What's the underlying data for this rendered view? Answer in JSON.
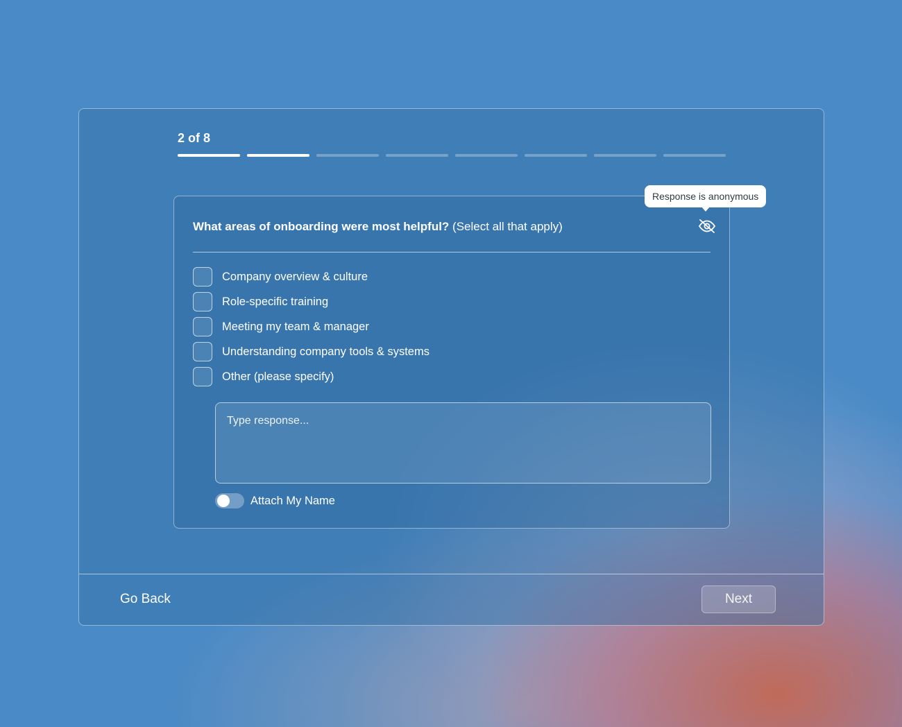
{
  "progress": {
    "label": "2 of 8",
    "current": 2,
    "total": 8
  },
  "question": {
    "text": "What areas of onboarding were most helpful?",
    "hint": "(Select all that apply)",
    "anonymous_tooltip": "Response is anonymous",
    "icon": "eye-off-icon"
  },
  "options": [
    {
      "label": "Company overview & culture",
      "checked": false
    },
    {
      "label": "Role-specific training",
      "checked": false
    },
    {
      "label": "Meeting my team & manager",
      "checked": false
    },
    {
      "label": "Understanding company tools & systems",
      "checked": false
    },
    {
      "label": "Other (please specify)",
      "checked": false
    }
  ],
  "response": {
    "placeholder": "Type response...",
    "value": ""
  },
  "attach_name": {
    "label": "Attach My Name",
    "enabled": false
  },
  "footer": {
    "back_label": "Go Back",
    "next_label": "Next"
  },
  "colors": {
    "background": "#4a8ac6",
    "accent_warm": "#c46854",
    "text": "#ffffff"
  }
}
